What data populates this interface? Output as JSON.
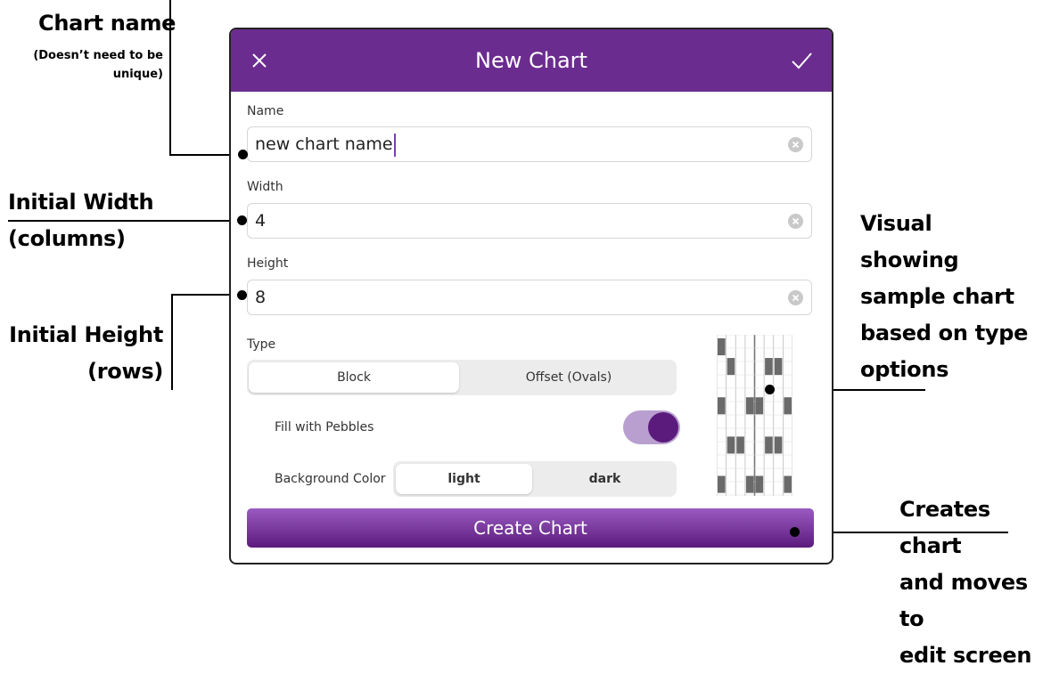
{
  "annotations": {
    "chart_name": {
      "title": "Chart name",
      "note": [
        "(Doesn’t need to be",
        "unique)"
      ]
    },
    "width": [
      "Initial Width",
      "(columns)"
    ],
    "height": [
      "Initial Height",
      "(rows)"
    ],
    "visual": [
      "Visual",
      "showing",
      "sample chart",
      "based on type",
      "options"
    ],
    "create": [
      "Creates chart",
      "and moves to",
      "edit screen"
    ]
  },
  "modal": {
    "title": "New Chart",
    "close_icon": "close-icon",
    "confirm_icon": "check-icon",
    "name": {
      "label": "Name",
      "value": "new chart name"
    },
    "width": {
      "label": "Width",
      "value": "4"
    },
    "height": {
      "label": "Height",
      "value": "8"
    },
    "type": {
      "label": "Type",
      "options": [
        "Block",
        "Offset (Ovals)"
      ],
      "selected": "Block"
    },
    "fill": {
      "label": "Fill with Pebbles",
      "on": true
    },
    "background": {
      "label": "Background Color",
      "options": [
        "light",
        "dark"
      ],
      "selected": "light"
    },
    "create_label": "Create Chart"
  },
  "colors": {
    "header": "#6b2c8f",
    "toggle_track": "#b89fcf",
    "toggle_knob": "#5b1b7c",
    "button_top": "#9a5bc2",
    "button_bottom": "#5b1b7c"
  }
}
